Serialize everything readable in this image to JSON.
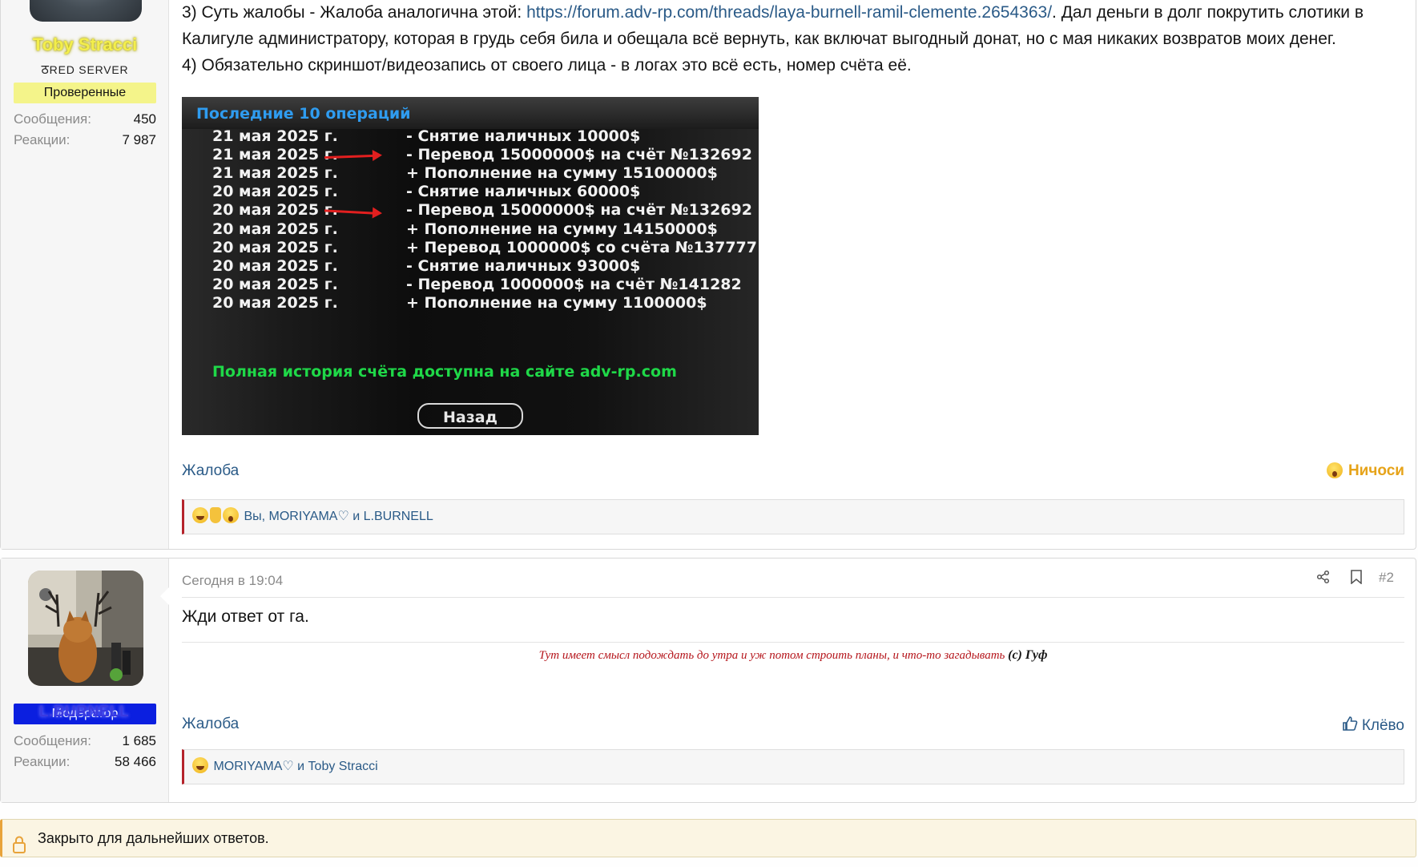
{
  "post1": {
    "author": {
      "name": "Toby Stracci",
      "subtitle": "RED SERVER",
      "role": "Проверенные",
      "role_color": "#f4f48a",
      "stats": [
        {
          "label": "Сообщения:",
          "value": "450"
        },
        {
          "label": "Реакции:",
          "value": "7 987"
        }
      ]
    },
    "lines": {
      "l3_prefix": "3) Суть жалобы - Жалоба аналогична этой: ",
      "l3_link": "https://forum.adv-rp.com/threads/laya-burnell-ramil-clemente.2654363/",
      "l3_suffix": ". Дал деньги в долг покрутить слотики в Калигуле администратору, которая в грудь себя била и обещала всё вернуть, как включат выгодный донат, но с мая никаких возвратов моих денег.",
      "l4": "4) Обязательно скриншот/видеозапись от своего лица - в логах это всё есть, номер счёта её."
    },
    "screenshot": {
      "title": "Последние 10 операций",
      "rows": [
        {
          "date": "21 мая 2025 г.",
          "text": "- Снятие наличных 10000$"
        },
        {
          "date": "21 мая 2025 г.",
          "text": "- Перевод 15000000$ на счёт №132692",
          "arrow": true
        },
        {
          "date": "21 мая 2025 г.",
          "text": "+ Пополнение на сумму 15100000$"
        },
        {
          "date": "20 мая 2025 г.",
          "text": "- Снятие наличных 60000$"
        },
        {
          "date": "20 мая 2025 г.",
          "text": "- Перевод 15000000$ на счёт №132692",
          "arrow": true
        },
        {
          "date": "20 мая 2025 г.",
          "text": "+ Пополнение на сумму 14150000$"
        },
        {
          "date": "20 мая 2025 г.",
          "text": "+ Перевод 1000000$ со счёта №137777"
        },
        {
          "date": "20 мая 2025 г.",
          "text": "- Снятие наличных 93000$"
        },
        {
          "date": "20 мая 2025 г.",
          "text": "- Перевод 1000000$ на счёт №141282"
        },
        {
          "date": "20 мая 2025 г.",
          "text": "+ Пополнение на сумму 1100000$"
        }
      ],
      "footer": "Полная история счёта доступна на сайте adv-rp.com",
      "button": "Назад"
    },
    "tag": "Жалоба",
    "reaction_label": "Ничоси",
    "reactions_text": "Вы, MORIYAMA♡ и L.BURNELL"
  },
  "post2": {
    "author": {
      "name": "L.BURNELL",
      "role": "Модератор",
      "role_color": "#0b1fe0",
      "stats": [
        {
          "label": "Сообщения:",
          "value": "1 685"
        },
        {
          "label": "Реакции:",
          "value": "58 466"
        }
      ]
    },
    "time": "Сегодня в 19:04",
    "number": "#2",
    "text": "Жди ответ от га.",
    "signature": {
      "quote": "Тут имеет смысл подождать до утра и уж потом строить планы, и что-то загадывать",
      "author": "(с) Гуф"
    },
    "tag": "Жалоба",
    "reaction_label": "Клёво",
    "reactions_text": "MORIYAMA♡ и Toby Stracci"
  },
  "closed_notice": "Закрыто для дальнейших ответов."
}
